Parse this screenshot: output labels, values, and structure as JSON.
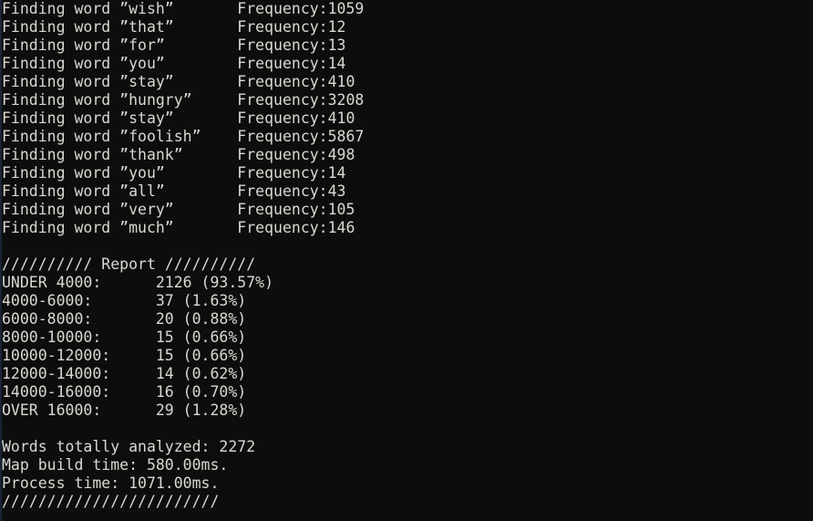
{
  "window": {
    "kind": "terminal-console-output",
    "background_color": "#0d0d0d",
    "text_color": "#d9d9d1",
    "left_edge_color": "#1a2336",
    "columns": 73,
    "rows": 28
  },
  "find_section": {
    "label_prefix": "Finding word",
    "frequency_label": "Frequency:",
    "quote_open": "”",
    "quote_close": "”",
    "entries": [
      {
        "word": "wish",
        "frequency": "1059"
      },
      {
        "word": "that",
        "frequency": "12"
      },
      {
        "word": "for",
        "frequency": "13"
      },
      {
        "word": "you",
        "frequency": "14"
      },
      {
        "word": "stay",
        "frequency": "410"
      },
      {
        "word": "hungry",
        "frequency": "3208"
      },
      {
        "word": "stay",
        "frequency": "410"
      },
      {
        "word": "foolish",
        "frequency": "5867"
      },
      {
        "word": "thank",
        "frequency": "498"
      },
      {
        "word": "you",
        "frequency": "14"
      },
      {
        "word": "all",
        "frequency": "43"
      },
      {
        "word": "very",
        "frequency": "105"
      },
      {
        "word": "much",
        "frequency": "146"
      }
    ]
  },
  "report": {
    "header_line": "////////// Report //////////",
    "header_title": "Report",
    "header_rule": "//////////",
    "rows": [
      {
        "range": "UNDER 4000:",
        "count": "2126",
        "percent": "(93.57%)"
      },
      {
        "range": "4000-6000:",
        "count": "37",
        "percent": "(1.63%)"
      },
      {
        "range": "6000-8000:",
        "count": "20",
        "percent": "(0.88%)"
      },
      {
        "range": "8000-10000:",
        "count": "15",
        "percent": "(0.66%)"
      },
      {
        "range": "10000-12000:",
        "count": "15",
        "percent": "(0.66%)"
      },
      {
        "range": "12000-14000:",
        "count": "14",
        "percent": "(0.62%)"
      },
      {
        "range": "14000-16000:",
        "count": "16",
        "percent": "(0.70%)"
      },
      {
        "range": "OVER 16000:",
        "count": "29",
        "percent": "(1.28%)"
      }
    ]
  },
  "summary": {
    "words_analyzed_line": "Words totally analyzed: 2272",
    "words_analyzed_label": "Words totally analyzed:",
    "words_analyzed_value": "2272",
    "map_build_time_line": "Map build time: 580.00ms.",
    "map_build_time_label": "Map build time:",
    "map_build_time_value": "580.00ms.",
    "process_time_line": "Process time: 1071.00ms.",
    "process_time_label": "Process time:",
    "process_time_value": "1071.00ms.",
    "footer_rule": "////////////////////////"
  },
  "rendered_lines": [
    "Finding word ”wish”       Frequency:1059",
    "Finding word ”that”       Frequency:12",
    "Finding word ”for”        Frequency:13",
    "Finding word ”you”        Frequency:14",
    "Finding word ”stay”       Frequency:410",
    "Finding word ”hungry”     Frequency:3208",
    "Finding word ”stay”       Frequency:410",
    "Finding word ”foolish”    Frequency:5867",
    "Finding word ”thank”      Frequency:498",
    "Finding word ”you”        Frequency:14",
    "Finding word ”all”        Frequency:43",
    "Finding word ”very”       Frequency:105",
    "Finding word ”much”       Frequency:146",
    "",
    "////////// Report //////////",
    "UNDER 4000:      2126 (93.57%)",
    "4000-6000:       37 (1.63%)",
    "6000-8000:       20 (0.88%)",
    "8000-10000:      15 (0.66%)",
    "10000-12000:     15 (0.66%)",
    "12000-14000:     14 (0.62%)",
    "14000-16000:     16 (0.70%)",
    "OVER 16000:      29 (1.28%)",
    "",
    "Words totally analyzed: 2272",
    "Map build time: 580.00ms.",
    "Process time: 1071.00ms.",
    "////////////////////////"
  ]
}
